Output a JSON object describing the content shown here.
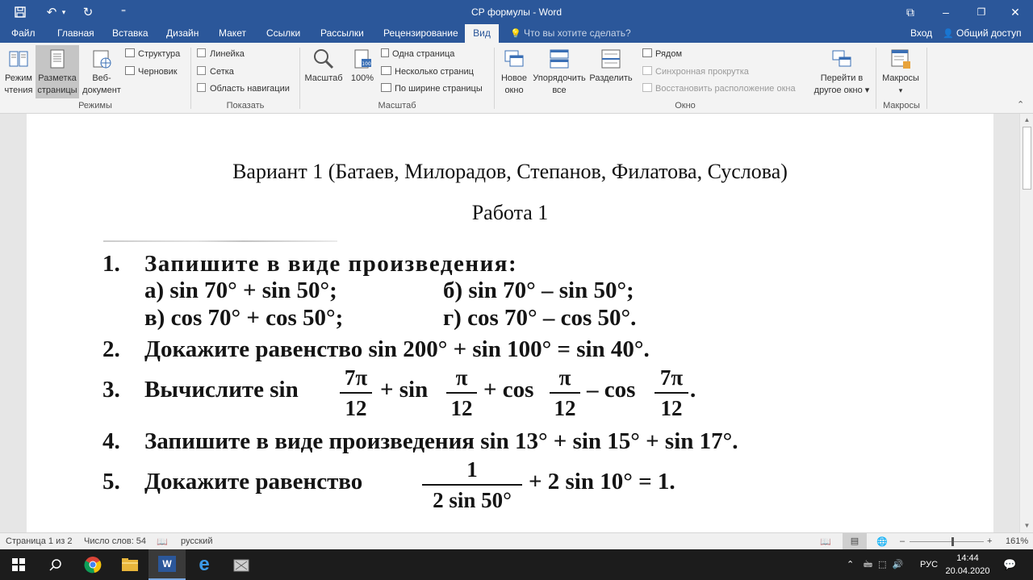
{
  "window": {
    "title": "СР формулы - Word",
    "min_glyph": "–",
    "restore_glyph": "❐",
    "close_glyph": "✕",
    "ribbon_display_glyph": "⧉"
  },
  "quick_access": {
    "save_glyph": "🖫",
    "undo_glyph": "↶",
    "undo_dropdown": "▾",
    "redo_glyph": "↻",
    "customize_glyph": "⁼"
  },
  "tabs": [
    {
      "label": "Файл",
      "active": false
    },
    {
      "label": "Главная",
      "active": false
    },
    {
      "label": "Вставка",
      "active": false
    },
    {
      "label": "Дизайн",
      "active": false
    },
    {
      "label": "Макет",
      "active": false
    },
    {
      "label": "Ссылки",
      "active": false
    },
    {
      "label": "Рассылки",
      "active": false
    },
    {
      "label": "Рецензирование",
      "active": false
    },
    {
      "label": "Вид",
      "active": true
    }
  ],
  "tell_me": {
    "icon": "lightbulb-icon",
    "glyph": "💡",
    "placeholder": "Что вы хотите сделать?"
  },
  "account": {
    "signin": "Вход",
    "share": "Общий доступ",
    "share_glyph": "👤"
  },
  "ribbon": {
    "modes": {
      "group_label": "Режимы",
      "read_mode": {
        "line1": "Режим",
        "line2": "чтения"
      },
      "print_layout": {
        "line1": "Разметка",
        "line2": "страницы"
      },
      "web_layout": {
        "line1": "Веб-",
        "line2": "документ"
      },
      "outline": "Структура",
      "draft": "Черновик"
    },
    "show": {
      "group_label": "Показать",
      "ruler": "Линейка",
      "gridlines": "Сетка",
      "nav_pane": "Область навигации"
    },
    "zoom": {
      "group_label": "Масштаб",
      "zoom": "Масштаб",
      "hundred": "100%",
      "one_page": "Одна страница",
      "multiple_pages": "Несколько страниц",
      "page_width": "По ширине страницы"
    },
    "window": {
      "group_label": "Окно",
      "new_window": {
        "line1": "Новое",
        "line2": "окно"
      },
      "arrange_all": {
        "line1": "Упорядочить",
        "line2": "все"
      },
      "split": "Разделить",
      "side_by_side": "Рядом",
      "sync_scroll": "Синхронная прокрутка",
      "reset_position": "Восстановить расположение окна",
      "switch_windows": {
        "line1": "Перейти в",
        "line2": "другое окно ▾"
      }
    },
    "macros": {
      "group_label": "Макросы",
      "macros": "Макросы",
      "dropdown_glyph": "▾"
    },
    "collapse_glyph": "⌃"
  },
  "document": {
    "heading": "Вариант 1 (Батаев, Милорадов, Степанов, Филатова, Суслова)",
    "subheading": "Работа 1",
    "problems": {
      "p1": {
        "num": "1.",
        "text": "Запишите в виде произведения:",
        "a": "а) sin 70° + sin 50°;",
        "b": "б) sin 70° – sin 50°;",
        "c": "в) cos 70° + cos 50°;",
        "d": "г) cos 70° – cos 50°."
      },
      "p2": {
        "num": "2.",
        "text": "Докажите равенство sin 200° + sin 100° = sin 40°."
      },
      "p3": {
        "num": "3.",
        "prefix": "Вычислите sin",
        "f1": {
          "n": "7π",
          "d": "12"
        },
        "plus_sin": "+ sin",
        "f2": {
          "n": "π",
          "d": "12"
        },
        "plus_cos": "+ cos",
        "f3": {
          "n": "π",
          "d": "12"
        },
        "minus_cos": "– cos",
        "f4": {
          "n": "7π",
          "d": "12"
        },
        "end": "."
      },
      "p4": {
        "num": "4.",
        "text": "Запишите в виде произведения sin 13° + sin 15° + sin 17°."
      },
      "p5": {
        "num": "5.",
        "prefix": "Докажите равенство",
        "f": {
          "n": "1",
          "d": "2 sin 50°"
        },
        "suffix": "+ 2 sin 10° = 1."
      }
    }
  },
  "scrollbar": {
    "up_glyph": "▲",
    "down_glyph": "▼"
  },
  "status_bar": {
    "page": "Страница 1 из 2",
    "words": "Число слов: 54",
    "proofing_glyph": "📖",
    "language": "русский",
    "zoom_minus": "–",
    "zoom_plus": "+",
    "zoom_level": "161%",
    "view_read_glyph": "📖",
    "view_print_glyph": "▤",
    "view_web_glyph": "🌐"
  },
  "taskbar": {
    "start_glyph": "⊞",
    "search_glyph": "⌕",
    "word_label": "W",
    "edge_label": "e",
    "tray_chevron": "⌃",
    "tray_glyphs": "🖮 ⬚ 🔊",
    "language": "РУС",
    "time": "14:44",
    "date": "20.04.2020",
    "notification_glyph": "💬"
  }
}
